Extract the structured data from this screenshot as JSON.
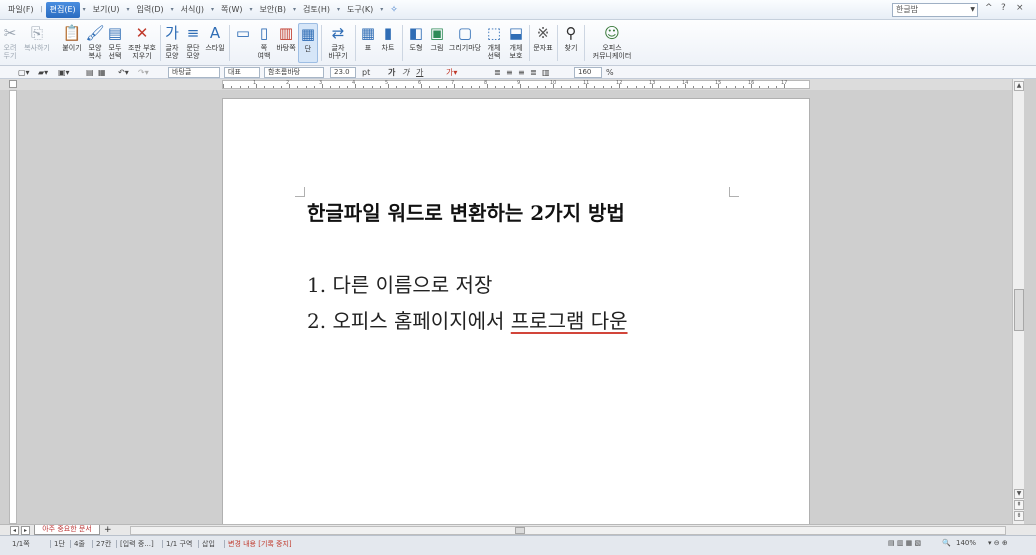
{
  "menubar": {
    "items": [
      {
        "label": "파일(F)",
        "active": false
      },
      {
        "label": "편집(E)",
        "active": true
      },
      {
        "label": "보기(U)",
        "active": false
      },
      {
        "label": "입력(D)",
        "active": false
      },
      {
        "label": "서식(J)",
        "active": false
      },
      {
        "label": "쪽(W)",
        "active": false
      },
      {
        "label": "보안(B)",
        "active": false
      },
      {
        "label": "검토(H)",
        "active": false
      },
      {
        "label": "도구(K)",
        "active": false
      }
    ],
    "style_combo": "한글밥",
    "window_controls": [
      "^",
      "?",
      "×"
    ]
  },
  "ribbon": {
    "buttons": [
      {
        "icon": "✂",
        "label": "오려\n두기",
        "name": "cut-button",
        "dim": true
      },
      {
        "icon": "⎘",
        "label": "복사하기",
        "name": "copy-button",
        "dim": true
      },
      {
        "icon": "📋",
        "label": "붙이기",
        "name": "paste-button",
        "dim": false
      },
      {
        "icon": "🖌",
        "label": "모양\n복사",
        "name": "format-copy-button",
        "dim": false
      },
      {
        "icon": "▤",
        "label": "모두\n선택",
        "name": "select-all-button",
        "dim": false
      },
      {
        "icon": "✕",
        "label": "조판 부호\n지우기",
        "name": "clear-codes-button",
        "dim": false
      },
      {
        "icon": "가",
        "label": "글자\n모양",
        "name": "char-shape-button",
        "dim": false
      },
      {
        "icon": "≡",
        "label": "문단\n모양",
        "name": "para-shape-button",
        "dim": false
      },
      {
        "icon": "A",
        "label": "스타일",
        "name": "style-button",
        "dim": false
      },
      {
        "icon": "▭",
        "label": "",
        "name": "page-view-button",
        "dim": false
      },
      {
        "icon": "▯",
        "label": "쪽\n여백",
        "name": "page-margin-button",
        "dim": false
      },
      {
        "icon": "▥",
        "label": "바탕쪽",
        "name": "master-page-button",
        "dim": false
      },
      {
        "icon": "▦",
        "label": "단",
        "name": "columns-button",
        "dim": false
      },
      {
        "icon": "⇄",
        "label": "글자\n바꾸기",
        "name": "replace-char-button",
        "dim": false
      },
      {
        "icon": "▦",
        "label": "표",
        "name": "table-button",
        "dim": false
      },
      {
        "icon": "▮",
        "label": "차트",
        "name": "chart-button",
        "dim": false
      },
      {
        "icon": "◧",
        "label": "도형",
        "name": "shape-button",
        "dim": false
      },
      {
        "icon": "▣",
        "label": "그림",
        "name": "picture-button",
        "dim": false
      },
      {
        "icon": "▢",
        "label": "그리기마당",
        "name": "clipart-button",
        "dim": false
      },
      {
        "icon": "⬚",
        "label": "개체\n선택",
        "name": "object-select-button",
        "dim": false
      },
      {
        "icon": "⬓",
        "label": "개체\n보호",
        "name": "object-protect-button",
        "dim": false
      },
      {
        "icon": "※",
        "label": "문자표",
        "name": "symbol-button",
        "dim": false
      },
      {
        "icon": "⚲",
        "label": "찾기",
        "name": "find-button",
        "dim": false
      },
      {
        "icon": "☺",
        "label": "오피스\n커뮤니케이터",
        "name": "communicator-button",
        "dim": false
      }
    ]
  },
  "format_toolbar": {
    "style": "바탕글",
    "lang": "대표",
    "font": "함초롬바탕",
    "font_size": "23.0",
    "size_unit": "pt",
    "bold": "가",
    "italic": "가",
    "underline": "가",
    "line_spacing": "160",
    "line_spacing_unit": "%"
  },
  "ruler": {
    "numbers": [
      "1",
      "2",
      "3",
      "4",
      "5",
      "6",
      "7",
      "8",
      "9",
      "10",
      "11",
      "12",
      "13",
      "14",
      "15",
      "16",
      "17"
    ]
  },
  "document": {
    "title": "한글파일 워드로 변환하는 2가지 방법",
    "line1": "1. 다른 이름으로 저장",
    "line2_prefix": "2. 오피스 홈페이지에서 ",
    "line2_underlined": "프로그램 다운"
  },
  "tabs": {
    "doc_tab": "아주 중요한 문서",
    "add": "+"
  },
  "statusbar": {
    "page": "1/1쪽",
    "section": "1단",
    "line": "4줄",
    "col": "27칸",
    "insert_status": "[입력 중...]",
    "block": "1/1 구역",
    "mode": "삽입",
    "change_tracking": "변경 내용 [기록 중지]",
    "zoom": "140%"
  }
}
